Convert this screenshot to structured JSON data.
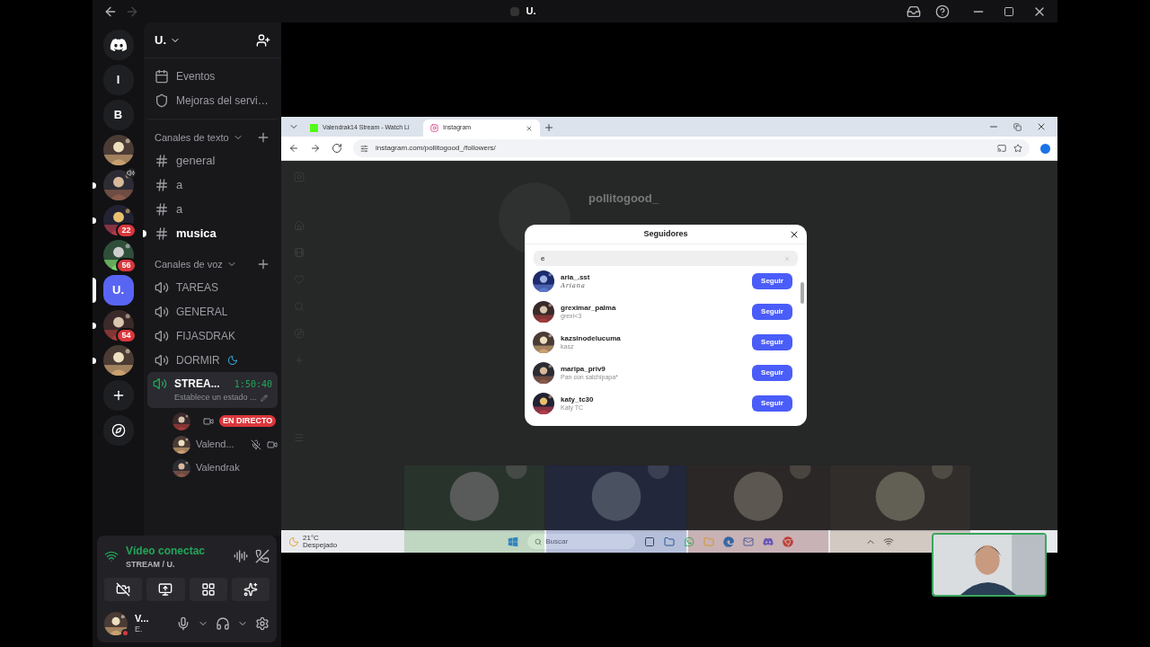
{
  "titlebar": {
    "title": "U."
  },
  "servers": [
    {
      "kind": "home",
      "selected": false,
      "unread": false
    },
    {
      "kind": "letter",
      "label": "l",
      "selected": false,
      "unread": false
    },
    {
      "kind": "letter",
      "label": "B",
      "selected": false,
      "unread": false
    },
    {
      "kind": "picture",
      "selected": false,
      "unread": false
    },
    {
      "kind": "picture",
      "speaker": true,
      "selected": false,
      "unread": true
    },
    {
      "kind": "picture",
      "badge": "22",
      "selected": false,
      "unread": true
    },
    {
      "kind": "picture",
      "badge": "56",
      "selected": false,
      "unread": false
    },
    {
      "kind": "letter",
      "label": "U.",
      "color": "#5865f2",
      "selected": true,
      "unread": false
    },
    {
      "kind": "picture",
      "badge": "54",
      "selected": false,
      "unread": true
    },
    {
      "kind": "picture",
      "selected": false,
      "unread": true
    },
    {
      "kind": "add",
      "selected": false,
      "unread": false
    },
    {
      "kind": "explore",
      "selected": false,
      "unread": false
    }
  ],
  "server_name": "U.",
  "menu_items": [
    {
      "kind": "events",
      "label": "Eventos"
    },
    {
      "kind": "boost",
      "label": "Mejoras del servi…"
    }
  ],
  "text_category": {
    "label": "Canales de texto"
  },
  "text_channels": [
    {
      "name": "general",
      "unread": false
    },
    {
      "name": "a",
      "unread": false
    },
    {
      "name": "a",
      "unread": false
    },
    {
      "name": "musica",
      "unread": true
    }
  ],
  "voice_category": {
    "label": "Canales de voz"
  },
  "voice_channels": [
    {
      "name": "TAREAS",
      "connected": false
    },
    {
      "name": "GENERAL",
      "connected": false
    },
    {
      "name": "FIJASDRAK",
      "connected": false
    },
    {
      "name": "DORMIR",
      "connected": false,
      "sleep": true
    },
    {
      "name": "STREA...",
      "connected": true,
      "timer": "1:50:40",
      "status": "Establece un estado ...",
      "members": [
        {
          "live": true,
          "live_label": "EN DIRECTO",
          "camera": true,
          "mic_muted": false
        },
        {
          "name": "Valend...",
          "live": false,
          "camera": true,
          "mic_muted": true
        },
        {
          "name": "Valendrak",
          "live": false,
          "camera": false,
          "mic_muted": false
        }
      ]
    }
  ],
  "voice_panel": {
    "status": "Vídeo conectac",
    "channel": "STREAM / U."
  },
  "user": {
    "name": "V...",
    "status": "E."
  },
  "browser": {
    "tabs": [
      {
        "title": "Valendrak14 Stream - Watch Li",
        "selected": false
      },
      {
        "title": "Instagram",
        "selected": true
      }
    ],
    "url": "instagram.com/pollitogood_/followers/"
  },
  "profile": {
    "username": "pollitogood_"
  },
  "modal": {
    "title": "Seguidores",
    "search_value": "e",
    "followers": [
      {
        "username": "aria_.sst",
        "fullname": "Ariana",
        "fancy": true,
        "button": "Seguir"
      },
      {
        "username": "greximar_palma",
        "fullname": "grexi<3",
        "fancy": false,
        "button": "Seguir"
      },
      {
        "username": "kazsinodelucuma",
        "fullname": "kasz",
        "fancy": false,
        "button": "Seguir"
      },
      {
        "username": "maripa_priv9",
        "fullname": "Pan con salchipapa*",
        "fancy": false,
        "button": "Seguir"
      },
      {
        "username": "katy_tc30",
        "fullname": "Katy TC",
        "fancy": false,
        "button": "Seguir"
      }
    ]
  },
  "taskbar": {
    "temperature": "21°C",
    "weather": "Despejado",
    "search_placeholder": "Buscar"
  }
}
